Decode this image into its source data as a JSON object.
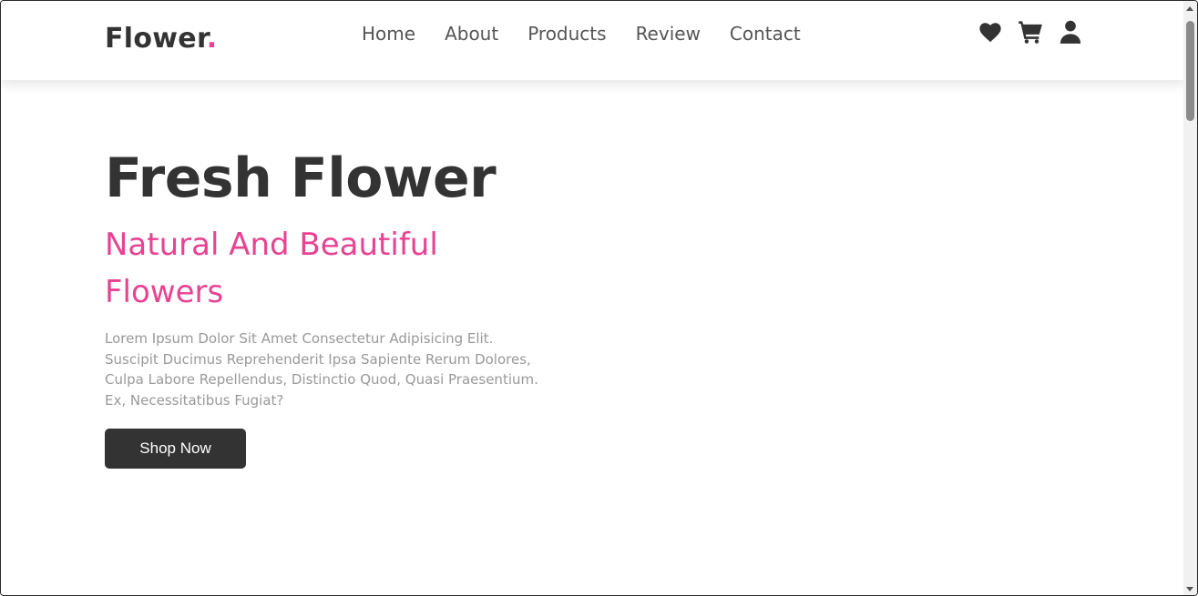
{
  "header": {
    "logo_text": "Flower",
    "logo_dot": ".",
    "nav": [
      "Home",
      "About",
      "Products",
      "Review",
      "Contact"
    ],
    "icons": [
      "heart-icon",
      "cart-icon",
      "user-icon"
    ]
  },
  "hero": {
    "title": "Fresh Flower",
    "subtitle": "Natural And Beautiful Flowers",
    "text": "Lorem Ipsum Dolor Sit Amet Consectetur Adipisicing Elit. Suscipit Ducimus Reprehenderit Ipsa Sapiente Rerum Dolores, Culpa Labore Repellendus, Distinctio Quod, Quasi Praesentium. Ex, Necessitatibus Fugiat?",
    "button_label": "Shop Now"
  },
  "colors": {
    "accent": "#e84393",
    "dark": "#333333",
    "muted": "#999999"
  }
}
